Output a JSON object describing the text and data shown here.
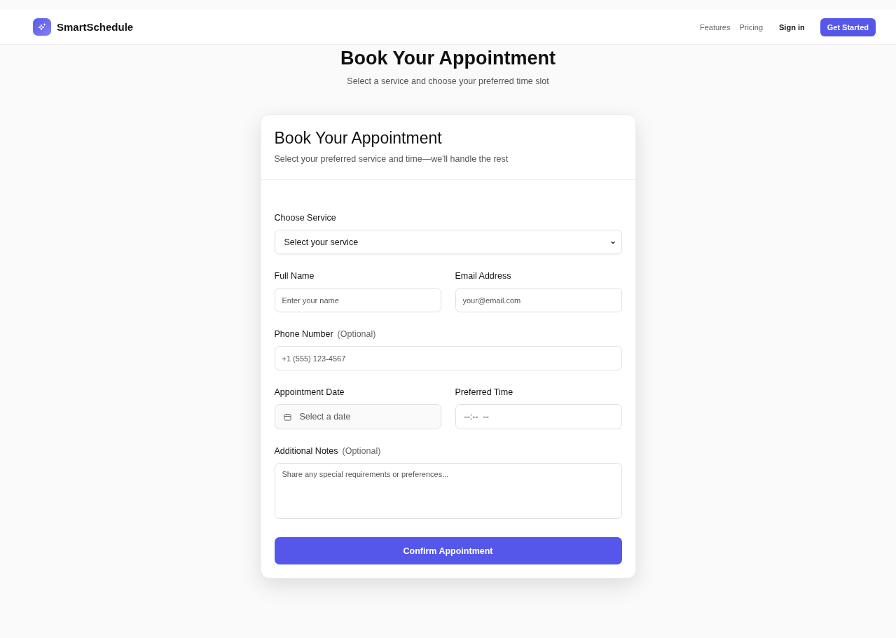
{
  "header": {
    "brand": "SmartSchedule",
    "nav": [
      "Features",
      "Pricing"
    ],
    "sign_in": "Sign in",
    "cta": "Get Started"
  },
  "hero": {
    "title": "Book Your Appointment",
    "subtitle": "Select a service and choose your preferred time slot"
  },
  "card": {
    "title": "Book Your Appointment",
    "subtitle": "Select your preferred service and time—we'll handle the rest",
    "rows": [
      [
        {
          "kind": "select",
          "label": "Choose Service",
          "value": "Select your service"
        }
      ],
      [
        {
          "kind": "text",
          "label": "Full Name",
          "placeholder": "Enter your name"
        },
        {
          "kind": "text",
          "label": "Email Address",
          "placeholder": "your@email.com"
        }
      ],
      [
        {
          "kind": "text",
          "label": "Phone Number",
          "optional": "(Optional)",
          "placeholder": "+1 (555) 123-4567"
        }
      ],
      [
        {
          "kind": "date",
          "label": "Appointment Date",
          "placeholder": "Select a date"
        },
        {
          "kind": "time",
          "label": "Preferred Time",
          "value": "--:--  --"
        }
      ],
      [
        {
          "kind": "textarea",
          "label": "Additional Notes",
          "optional": "(Optional)",
          "placeholder": "Share any special requirements or preferences..."
        }
      ]
    ],
    "submit": "Confirm Appointment"
  }
}
